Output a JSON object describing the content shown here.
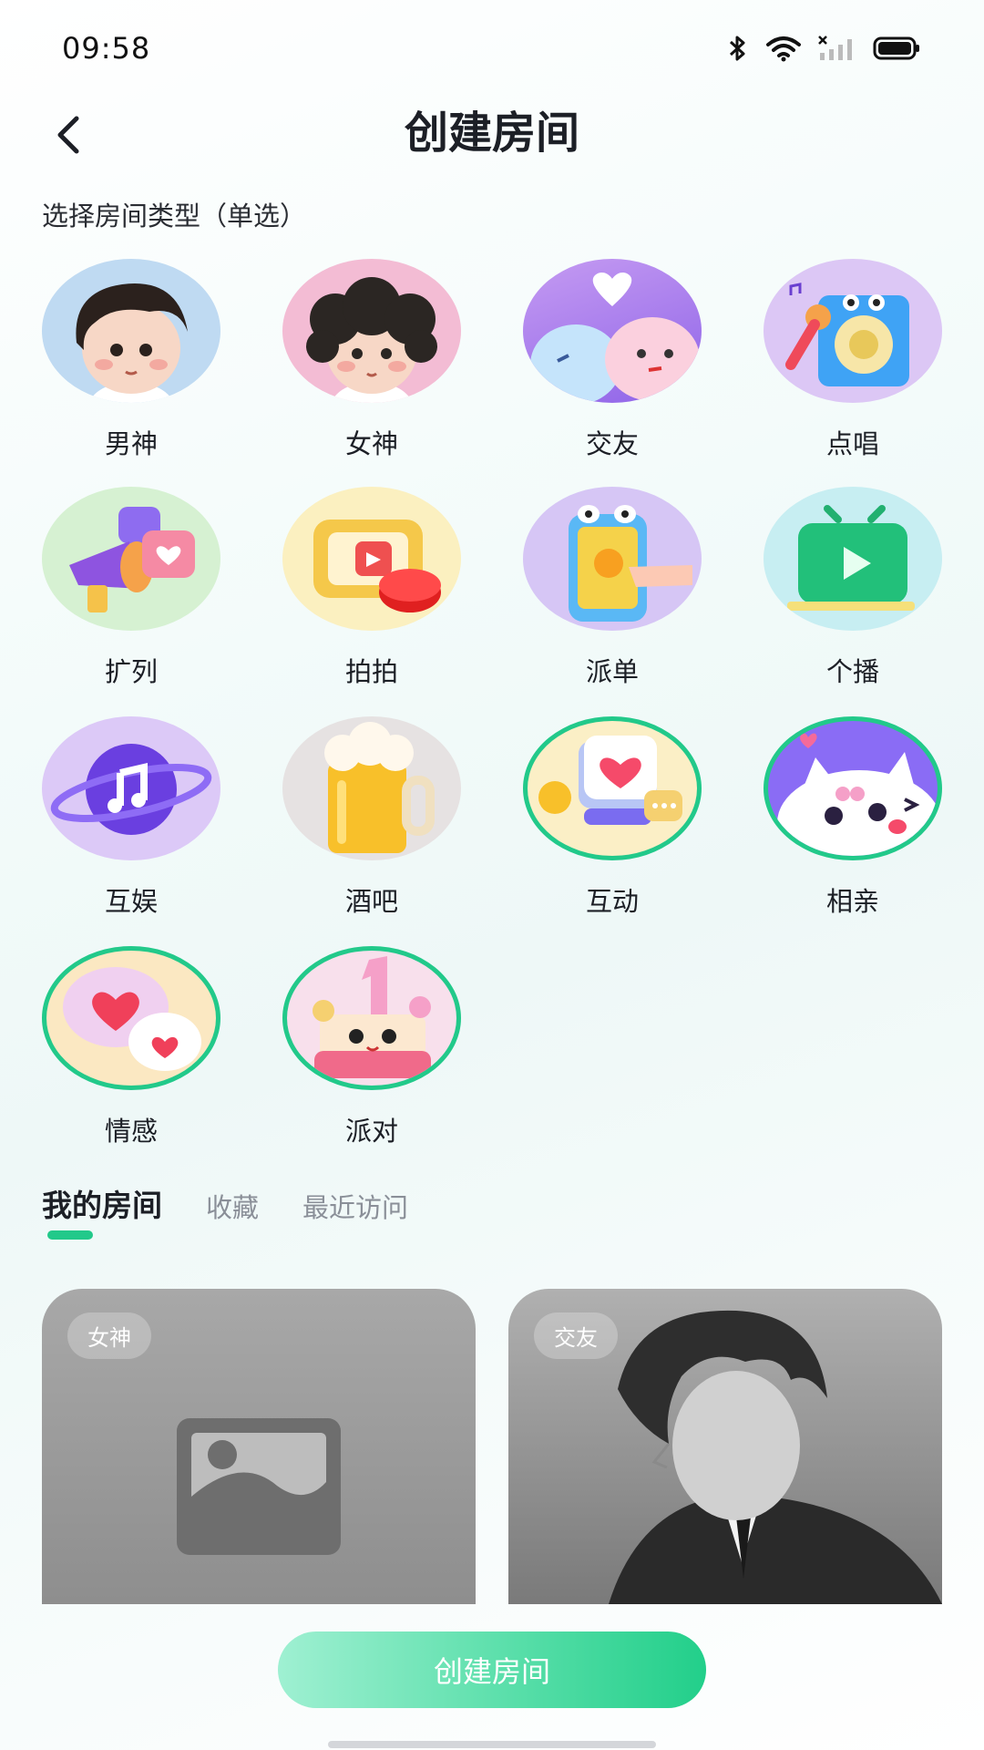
{
  "status_bar": {
    "time": "09:58",
    "icons": [
      "bluetooth-icon",
      "wifi-icon",
      "signal-icon",
      "battery-icon"
    ]
  },
  "header": {
    "title": "创建房间",
    "back_icon": "chevron-left-icon"
  },
  "room_type": {
    "section_label": "选择房间类型（单选）",
    "items": [
      {
        "label": "男神",
        "icon": "boy-avatar-icon",
        "selected": false
      },
      {
        "label": "女神",
        "icon": "girl-avatar-icon",
        "selected": false
      },
      {
        "label": "交友",
        "icon": "friends-bubbles-icon",
        "selected": false
      },
      {
        "label": "点唱",
        "icon": "karaoke-speaker-icon",
        "selected": false
      },
      {
        "label": "扩列",
        "icon": "megaphone-icon",
        "selected": false
      },
      {
        "label": "拍拍",
        "icon": "tap-button-icon",
        "selected": false
      },
      {
        "label": "派单",
        "icon": "phone-tap-icon",
        "selected": false
      },
      {
        "label": "个播",
        "icon": "tv-play-icon",
        "selected": false
      },
      {
        "label": "互娱",
        "icon": "music-planet-icon",
        "selected": false
      },
      {
        "label": "酒吧",
        "icon": "beer-mug-icon",
        "selected": false
      },
      {
        "label": "互动",
        "icon": "chat-heart-icon",
        "selected": true
      },
      {
        "label": "相亲",
        "icon": "cute-cat-icon",
        "selected": true
      },
      {
        "label": "情感",
        "icon": "heart-bubbles-icon",
        "selected": true
      },
      {
        "label": "派对",
        "icon": "party-cake-icon",
        "selected": true
      }
    ]
  },
  "tabs": [
    {
      "label": "我的房间",
      "active": true
    },
    {
      "label": "收藏",
      "active": false
    },
    {
      "label": "最近访问",
      "active": false
    }
  ],
  "rooms": [
    {
      "badge": "女神",
      "image": "image-placeholder-icon"
    },
    {
      "badge": "交友",
      "image": "man-portrait"
    }
  ],
  "primary_button": {
    "label": "创建房间"
  },
  "colors": {
    "accent": "#22c98a",
    "title": "#1c1f26",
    "muted": "#8a8f98"
  }
}
